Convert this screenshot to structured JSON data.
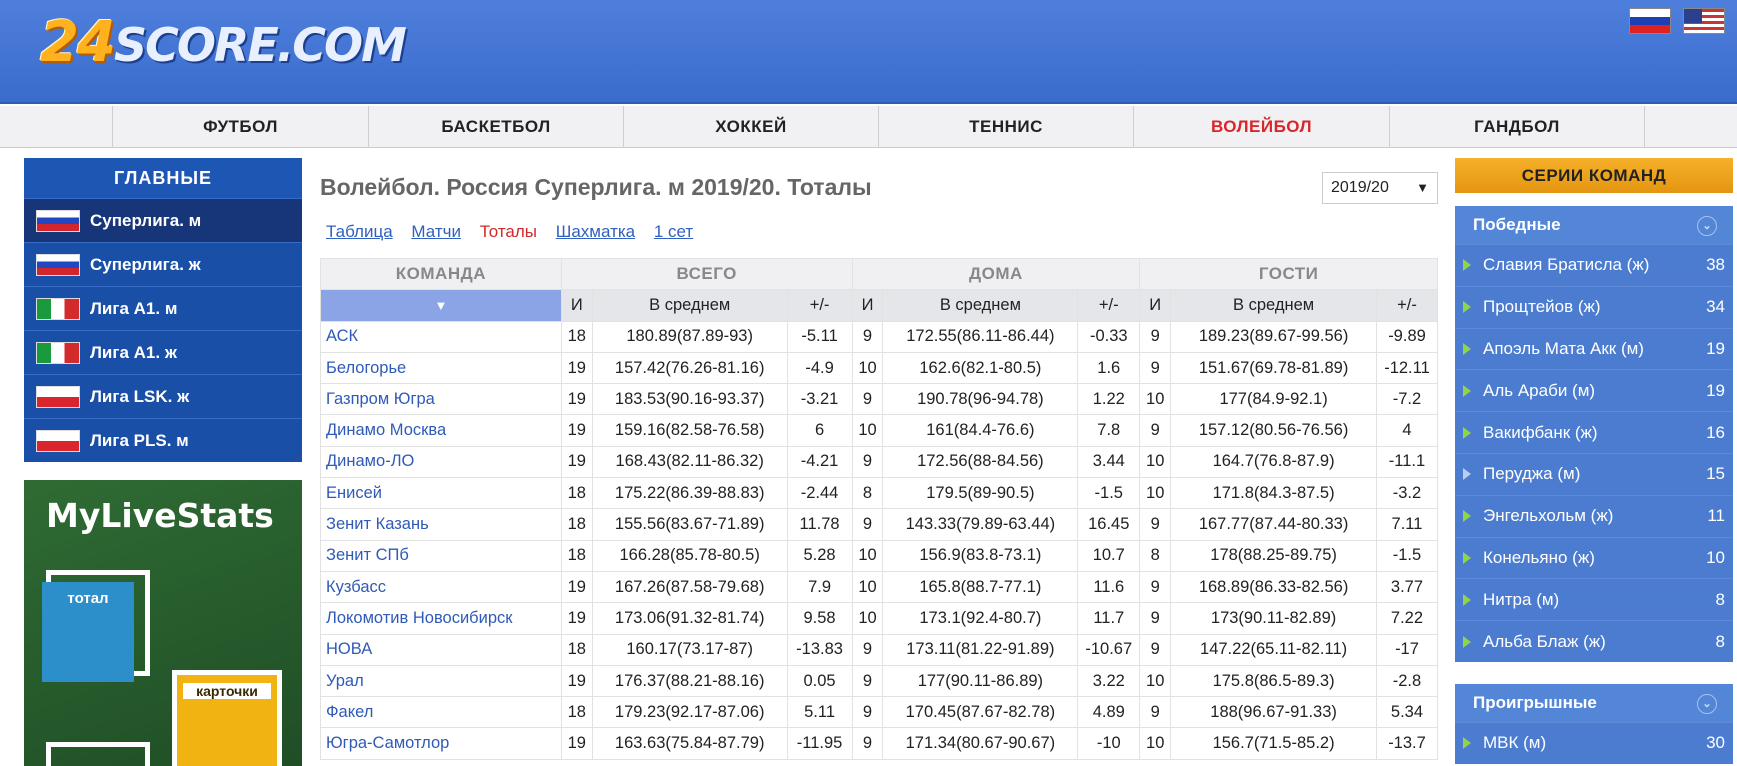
{
  "logo": {
    "num": "24",
    "text": "SCORE.COM"
  },
  "nav": [
    "ФУТБОЛ",
    "БАСКЕТБОЛ",
    "ХОККЕЙ",
    "ТЕННИС",
    "ВОЛЕЙБОЛ",
    "ГАНДБОЛ"
  ],
  "nav_active": "ВОЛЕЙБОЛ",
  "left": {
    "head": "ГЛАВНЫЕ",
    "items": [
      {
        "label": "Суперлига. м",
        "flag": "ru"
      },
      {
        "label": "Суперлига. ж",
        "flag": "ru"
      },
      {
        "label": "Лига А1. м",
        "flag": "it"
      },
      {
        "label": "Лига А1. ж",
        "flag": "it"
      },
      {
        "label": "Лига LSK. ж",
        "flag": "pl"
      },
      {
        "label": "Лига PLS. м",
        "flag": "pl"
      }
    ]
  },
  "ad": {
    "title": "MyLiveStats",
    "tile1": "тотал",
    "tile2": "карточки"
  },
  "page_title": "Волейбол. Россия Суперлига. м 2019/20. Тоталы",
  "season": "2019/20",
  "tabs": [
    "Таблица",
    "Матчи",
    "Тоталы",
    "Шахматка",
    "1 сет"
  ],
  "tab_active": "Тоталы",
  "table": {
    "groups": [
      "КОМАНДА",
      "ВСЕГО",
      "ДОМА",
      "ГОСТИ"
    ],
    "sub": [
      "И",
      "В среднем",
      "+/-"
    ],
    "rows": [
      [
        "АСК",
        "18",
        "180.89(87.89-93)",
        "-5.11",
        "9",
        "172.55(86.11-86.44)",
        "-0.33",
        "9",
        "189.23(89.67-99.56)",
        "-9.89"
      ],
      [
        "Белогорье",
        "19",
        "157.42(76.26-81.16)",
        "-4.9",
        "10",
        "162.6(82.1-80.5)",
        "1.6",
        "9",
        "151.67(69.78-81.89)",
        "-12.11"
      ],
      [
        "Газпром Югра",
        "19",
        "183.53(90.16-93.37)",
        "-3.21",
        "9",
        "190.78(96-94.78)",
        "1.22",
        "10",
        "177(84.9-92.1)",
        "-7.2"
      ],
      [
        "Динамо Москва",
        "19",
        "159.16(82.58-76.58)",
        "6",
        "10",
        "161(84.4-76.6)",
        "7.8",
        "9",
        "157.12(80.56-76.56)",
        "4"
      ],
      [
        "Динамо-ЛО",
        "19",
        "168.43(82.11-86.32)",
        "-4.21",
        "9",
        "172.56(88-84.56)",
        "3.44",
        "10",
        "164.7(76.8-87.9)",
        "-11.1"
      ],
      [
        "Енисей",
        "18",
        "175.22(86.39-88.83)",
        "-2.44",
        "8",
        "179.5(89-90.5)",
        "-1.5",
        "10",
        "171.8(84.3-87.5)",
        "-3.2"
      ],
      [
        "Зенит Казань",
        "18",
        "155.56(83.67-71.89)",
        "11.78",
        "9",
        "143.33(79.89-63.44)",
        "16.45",
        "9",
        "167.77(87.44-80.33)",
        "7.11"
      ],
      [
        "Зенит СПб",
        "18",
        "166.28(85.78-80.5)",
        "5.28",
        "10",
        "156.9(83.8-73.1)",
        "10.7",
        "8",
        "178(88.25-89.75)",
        "-1.5"
      ],
      [
        "Кузбасс",
        "19",
        "167.26(87.58-79.68)",
        "7.9",
        "10",
        "165.8(88.7-77.1)",
        "11.6",
        "9",
        "168.89(86.33-82.56)",
        "3.77"
      ],
      [
        "Локомотив Новосибирск",
        "19",
        "173.06(91.32-81.74)",
        "9.58",
        "10",
        "173.1(92.4-80.7)",
        "11.7",
        "9",
        "173(90.11-82.89)",
        "7.22"
      ],
      [
        "НОВА",
        "18",
        "160.17(73.17-87)",
        "-13.83",
        "9",
        "173.11(81.22-91.89)",
        "-10.67",
        "9",
        "147.22(65.11-82.11)",
        "-17"
      ],
      [
        "Урал",
        "19",
        "176.37(88.21-88.16)",
        "0.05",
        "9",
        "177(90.11-86.89)",
        "3.22",
        "10",
        "175.8(86.5-89.3)",
        "-2.8"
      ],
      [
        "Факел",
        "18",
        "179.23(92.17-87.06)",
        "5.11",
        "9",
        "170.45(87.67-82.78)",
        "4.89",
        "9",
        "188(96.67-91.33)",
        "5.34"
      ],
      [
        "Югра-Самотлор",
        "19",
        "163.63(75.84-87.79)",
        "-11.95",
        "9",
        "171.34(80.67-90.67)",
        "-10",
        "10",
        "156.7(71.5-85.2)",
        "-13.7"
      ]
    ]
  },
  "right": {
    "series_button": "СЕРИИ КОМАНД",
    "wins_head": "Победные",
    "wins": [
      {
        "name": "Славия Братисла (ж)",
        "count": "38"
      },
      {
        "name": "Прощтейов (ж)",
        "count": "34"
      },
      {
        "name": "Апоэль Мата Акк (м)",
        "count": "19"
      },
      {
        "name": "Аль Араби (м)",
        "count": "19"
      },
      {
        "name": "Вакифбанк (ж)",
        "count": "16"
      },
      {
        "name": "Перуджа (м)",
        "count": "15"
      },
      {
        "name": "Энгельхольм (ж)",
        "count": "11"
      },
      {
        "name": "Конельяно (ж)",
        "count": "10"
      },
      {
        "name": "Нитра (м)",
        "count": "8"
      },
      {
        "name": "Альба Блаж (ж)",
        "count": "8"
      }
    ],
    "loss_head": "Проигрышные",
    "losses": [
      {
        "name": "МВК (м)",
        "count": "30"
      }
    ]
  }
}
